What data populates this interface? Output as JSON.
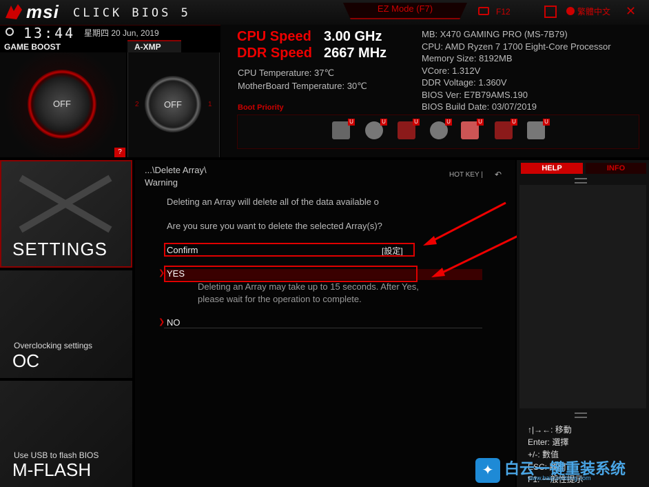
{
  "header": {
    "logo_text": "msi",
    "logo_sub": "CLICK BIOS 5",
    "ez_mode": "EZ Mode (F7)",
    "f12": "F12",
    "language": "繁體中文",
    "close": "✕"
  },
  "clock": {
    "time": "13:44",
    "date": "星期四  20 Jun, 2019"
  },
  "game_boost": {
    "label": "GAME BOOST",
    "state": "OFF"
  },
  "axmp": {
    "label": "A-XMP",
    "state": "OFF",
    "left_num": "2",
    "right_num": "1"
  },
  "help_badge": "?",
  "cpu": {
    "cpu_speed_label": "CPU Speed",
    "cpu_speed_value": "3.00 GHz",
    "ddr_speed_label": "DDR Speed",
    "ddr_speed_value": "2667 MHz",
    "cpu_temp": "CPU Temperature: 37℃",
    "mb_temp": "MotherBoard Temperature: 30℃",
    "info": [
      "MB: X470 GAMING PRO (MS-7B79)",
      "CPU: AMD Ryzen 7 1700 Eight-Core Processor",
      "Memory Size: 8192MB",
      "VCore: 1.312V",
      "DDR Voltage: 1.360V",
      "BIOS Ver: E7B79AMS.190",
      "BIOS Build Date: 03/07/2019"
    ],
    "boot_priority": "Boot Priority",
    "boot_badge": "U",
    "boot_devices": [
      "hdd-icon",
      "cd-icon",
      "usb-icon",
      "usb-cd-icon",
      "usb-drive-icon",
      "usb-floppy-icon",
      "network-icon"
    ]
  },
  "sidebar": {
    "settings": "SETTINGS",
    "oc_sub": "Overclocking settings",
    "oc": "OC",
    "mflash_sub": "Use USB to flash BIOS",
    "mflash": "M-FLASH"
  },
  "main": {
    "breadcrumb": "...\\Delete Array\\",
    "title": "Warning",
    "hotkey": "HOT KEY  |",
    "msg1": "Deleting an Array will delete all of the data available o",
    "msg2": "Are you sure you want to delete the selected Array(s)?",
    "confirm_label": "Confirm",
    "confirm_value": "[設定]",
    "yes": "YES",
    "yes_desc": "Deleting an Array may take up to 15 seconds. After Yes, please wait for the operation to complete.",
    "no": "NO"
  },
  "help": {
    "help_tab": "HELP",
    "info_tab": "INFO",
    "keys": [
      "↑|→←: 移動",
      "Enter: 選擇",
      "+/-: 數值",
      "ESC: 離開",
      "F1: 一般性提示"
    ]
  },
  "watermark": {
    "text": "白云一键重装系统",
    "url": "www.baiyunxitong.com"
  },
  "colors": {
    "accent": "#e00000",
    "dark_red": "#8b0000",
    "background": "#000000"
  }
}
